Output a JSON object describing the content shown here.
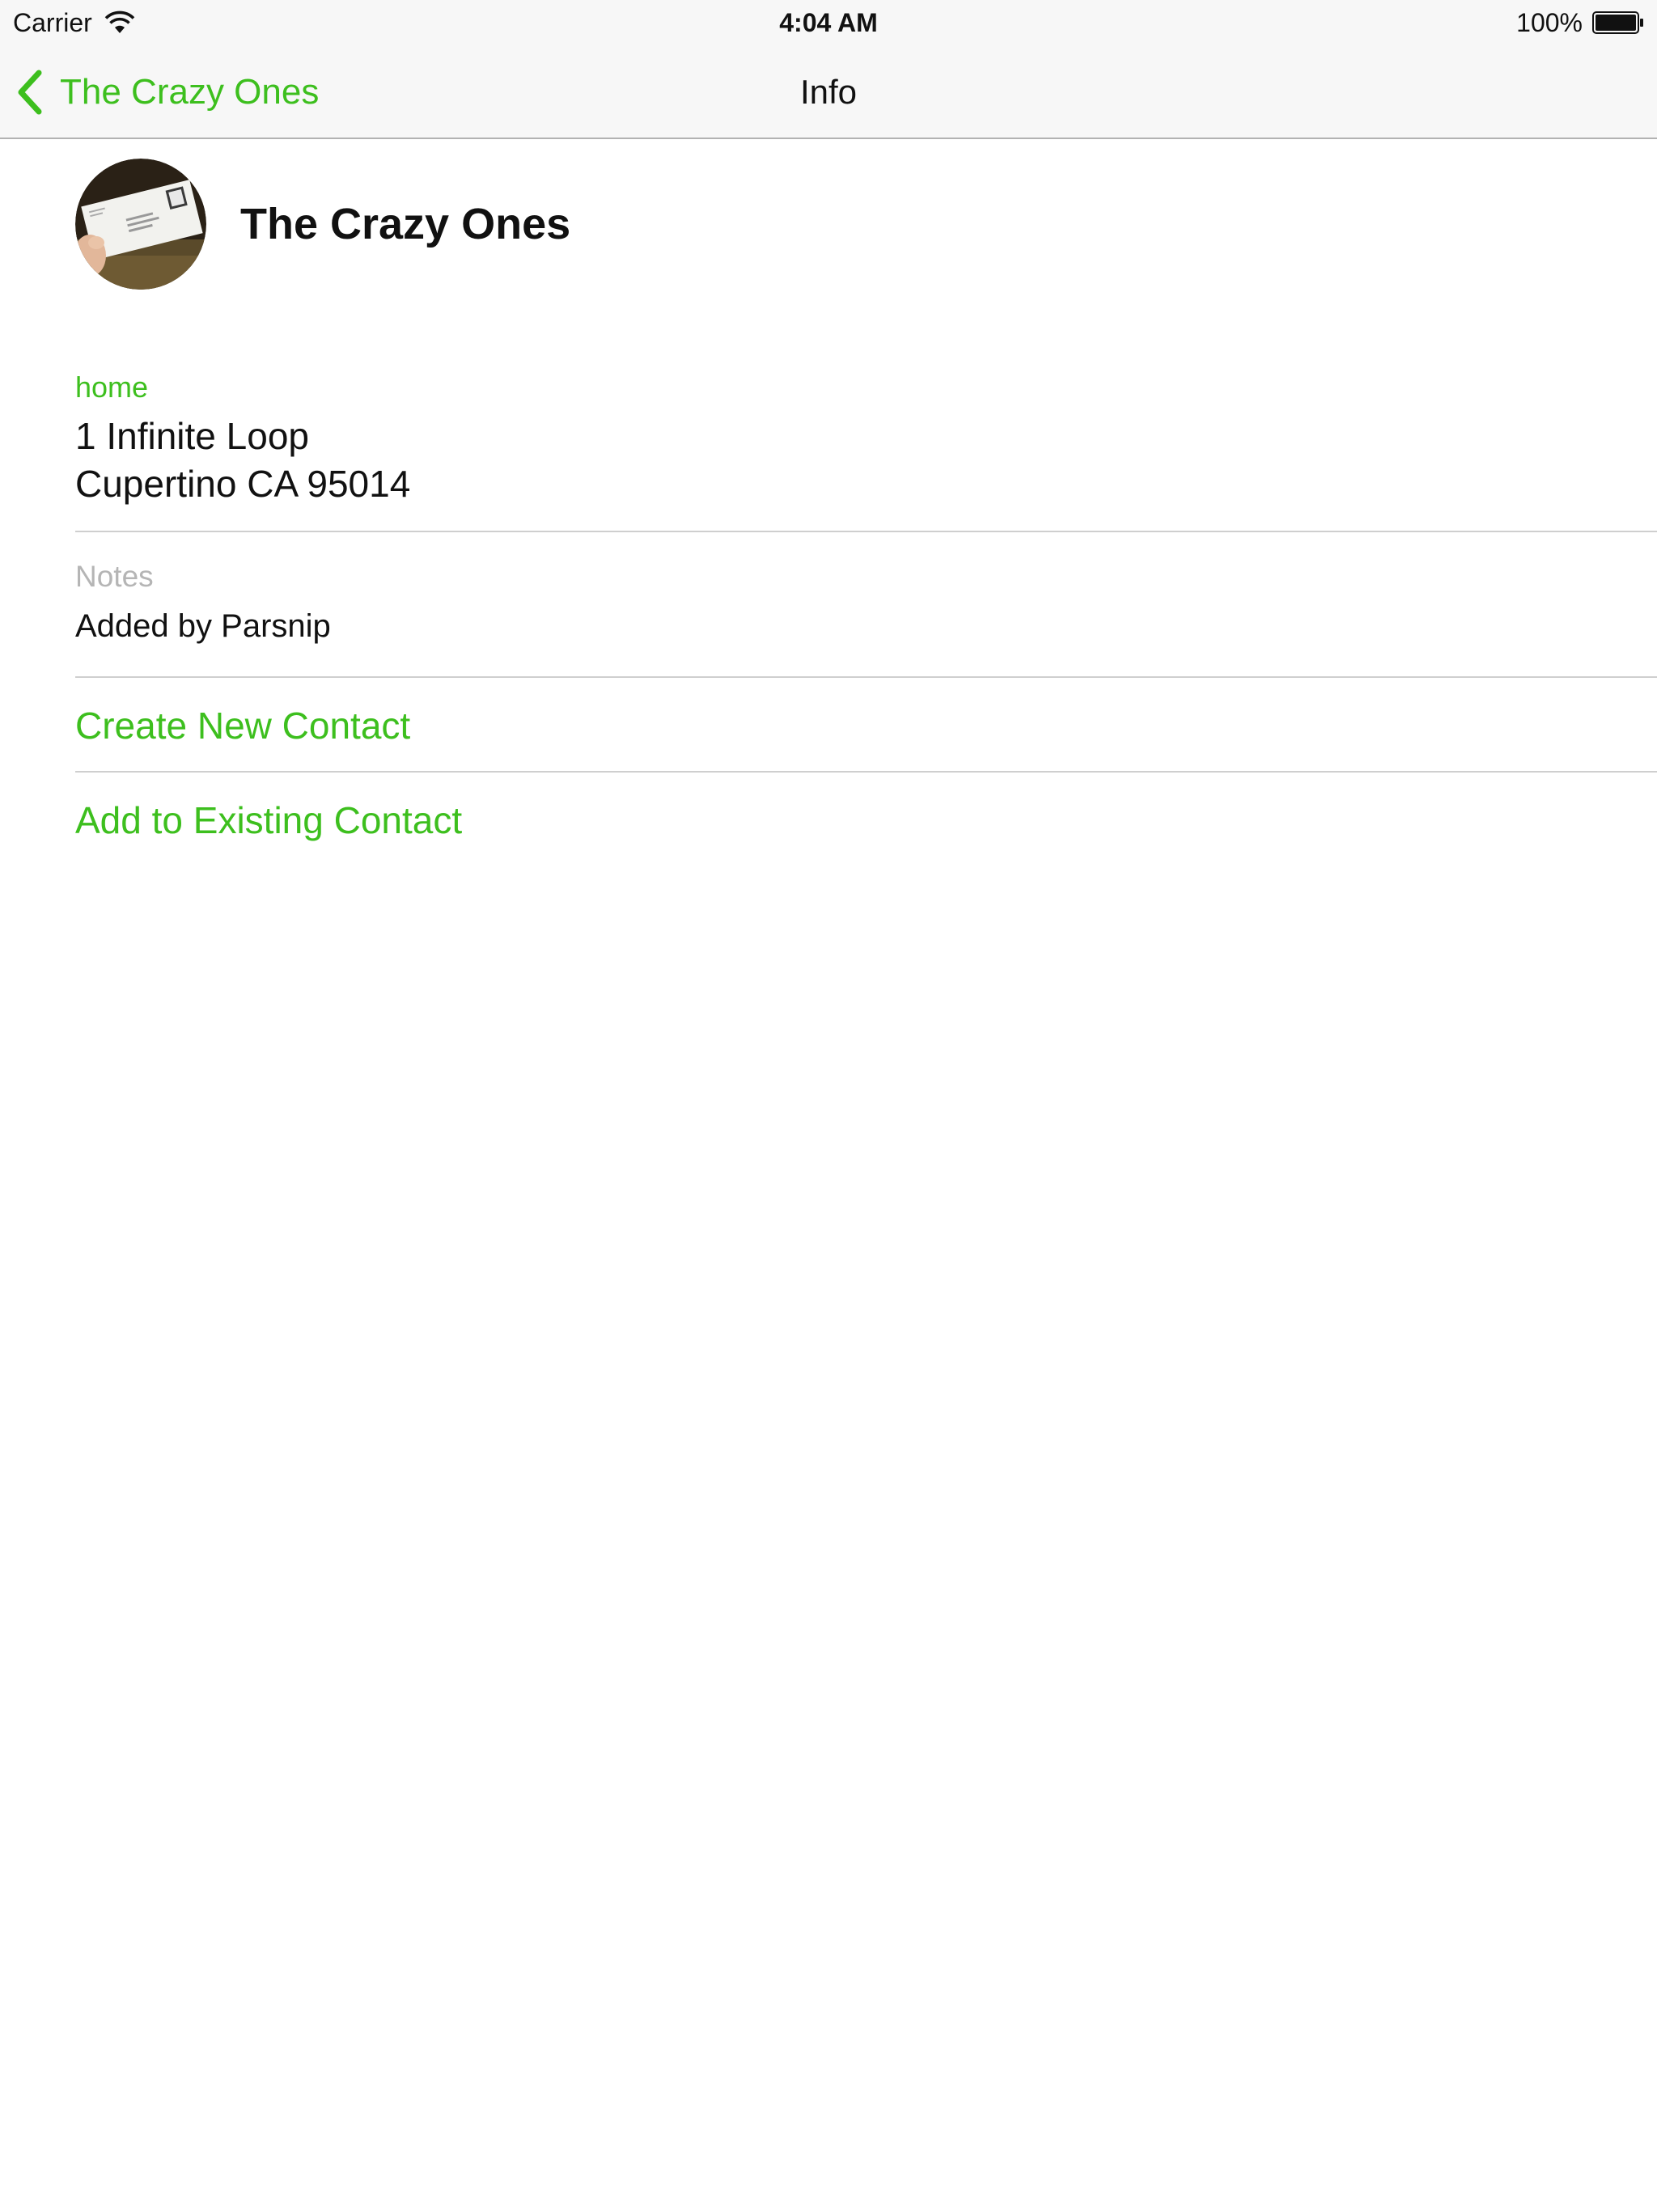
{
  "colors": {
    "accent": "#3dbf1e",
    "text": "#111111",
    "muted": "#b5b5b5",
    "separator": "#cfcfcf",
    "bar_background": "#f7f7f7"
  },
  "status_bar": {
    "carrier": "Carrier",
    "time": "4:04 AM",
    "battery_percent": "100%",
    "battery_level": 1.0,
    "icons": [
      "wifi-icon",
      "battery-icon"
    ]
  },
  "nav": {
    "back_label": "The Crazy Ones",
    "back_icon": "chevron-left-icon",
    "title": "Info"
  },
  "contact": {
    "name": "The Crazy Ones",
    "avatar_icon": "envelope-photo-avatar"
  },
  "address": {
    "label": "home",
    "line1": "1 Infinite Loop",
    "line2": "Cupertino CA 95014"
  },
  "notes": {
    "label": "Notes",
    "value": "Added by Parsnip"
  },
  "actions": {
    "create_new": "Create New Contact",
    "add_existing": "Add to Existing Contact"
  }
}
